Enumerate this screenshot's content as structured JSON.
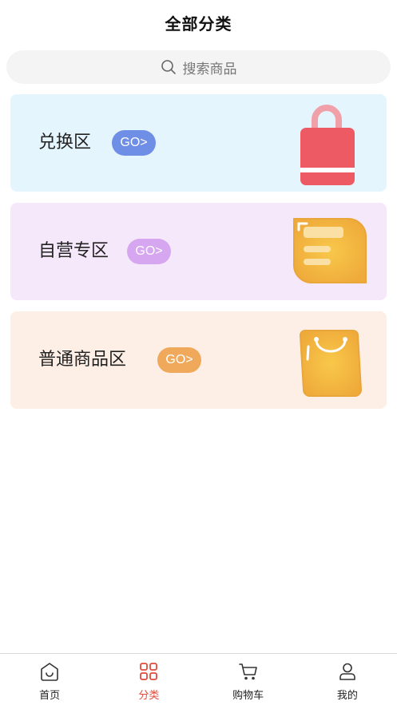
{
  "header": {
    "title": "全部分类"
  },
  "search": {
    "placeholder": "搜索商品",
    "icon": "search-icon"
  },
  "categories": [
    {
      "label": "兑换区",
      "go": "GO>",
      "color": "#6f8fe6",
      "bg": "#e5f5fd",
      "icon": "lock-bag-icon"
    },
    {
      "label": "自营专区",
      "go": "GO>",
      "color": "#d6a6f0",
      "bg": "#f6e8fb",
      "icon": "document-card-icon"
    },
    {
      "label": "普通商品区",
      "go": "GO>",
      "color": "#f0a85a",
      "bg": "#fdeee6",
      "icon": "shopping-bag-icon"
    }
  ],
  "tabbar": {
    "active_color": "#e24a3b",
    "items": [
      {
        "label": "首页",
        "icon": "home-icon",
        "active": false
      },
      {
        "label": "分类",
        "icon": "grid-icon",
        "active": true
      },
      {
        "label": "购物车",
        "icon": "cart-icon",
        "active": false
      },
      {
        "label": "我的",
        "icon": "user-icon",
        "active": false
      }
    ]
  }
}
